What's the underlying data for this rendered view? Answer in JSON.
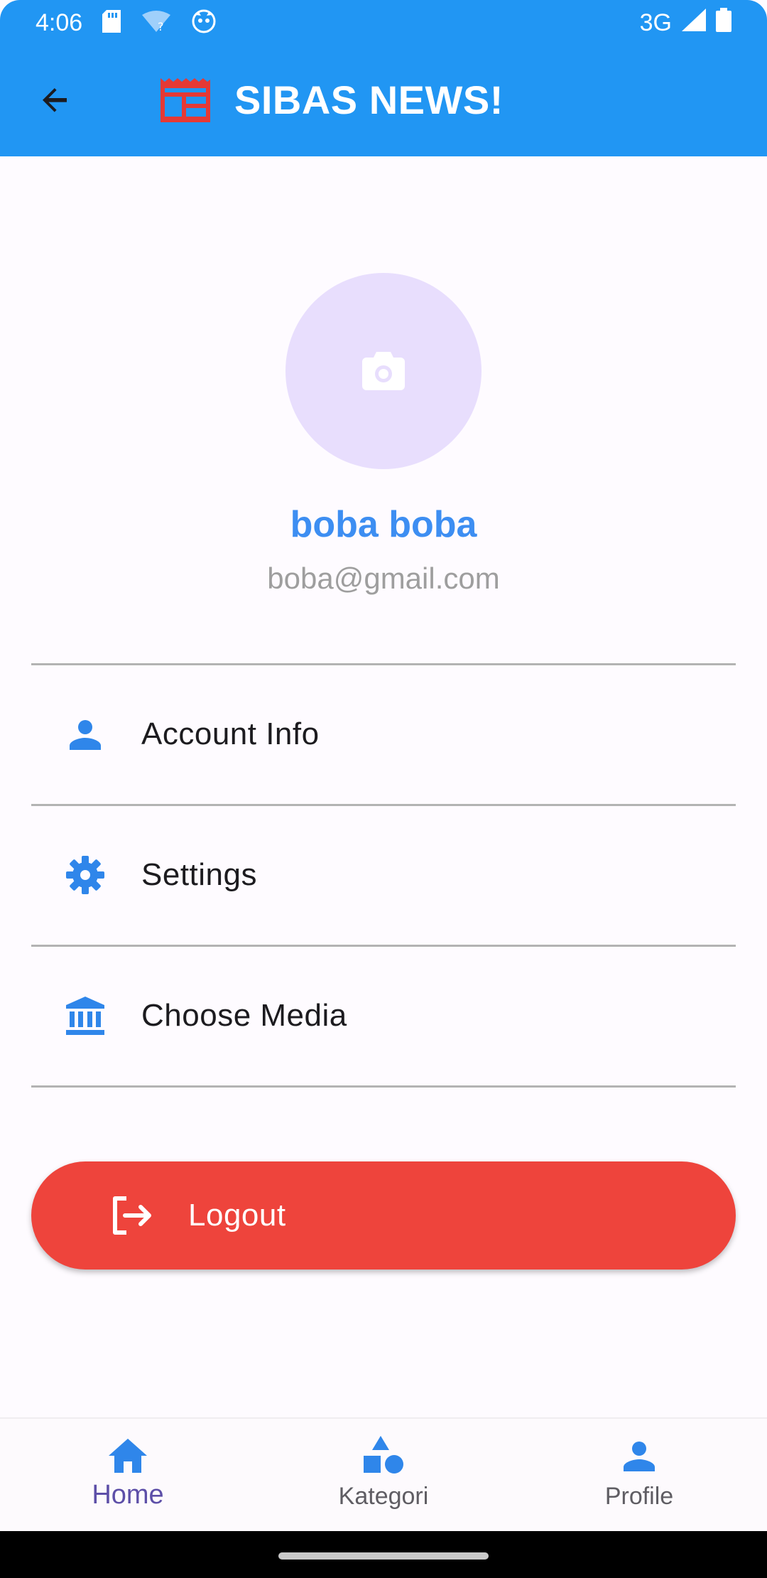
{
  "status_bar": {
    "time": "4:06",
    "network": "3G",
    "icons": [
      "sd-card-icon",
      "wifi-question-icon",
      "cat-icon",
      "signal-icon",
      "battery-icon"
    ]
  },
  "app_bar": {
    "title": "SIBAS NEWS!",
    "back_icon": "arrow-back-icon",
    "logo_icon": "newspaper-icon",
    "colors": {
      "background": "#2196f3",
      "logo": "#e53935"
    }
  },
  "profile": {
    "avatar_icon": "camera-icon",
    "name": "boba boba",
    "email": "boba@gmail.com"
  },
  "menu": {
    "items": [
      {
        "label": "Account Info",
        "icon": "person-icon"
      },
      {
        "label": "Settings",
        "icon": "gear-icon"
      },
      {
        "label": "Choose Media",
        "icon": "bank-icon"
      }
    ]
  },
  "logout": {
    "label": "Logout",
    "icon": "logout-icon",
    "color": "#ee443c"
  },
  "bottom_nav": {
    "items": [
      {
        "label": "Home",
        "icon": "home-icon",
        "active": true
      },
      {
        "label": "Kategori",
        "icon": "category-shapes-icon",
        "active": false
      },
      {
        "label": "Profile",
        "icon": "person-icon",
        "active": false
      }
    ]
  },
  "colors": {
    "accent": "#3d8ef2",
    "active_nav": "#5d4fa8"
  }
}
